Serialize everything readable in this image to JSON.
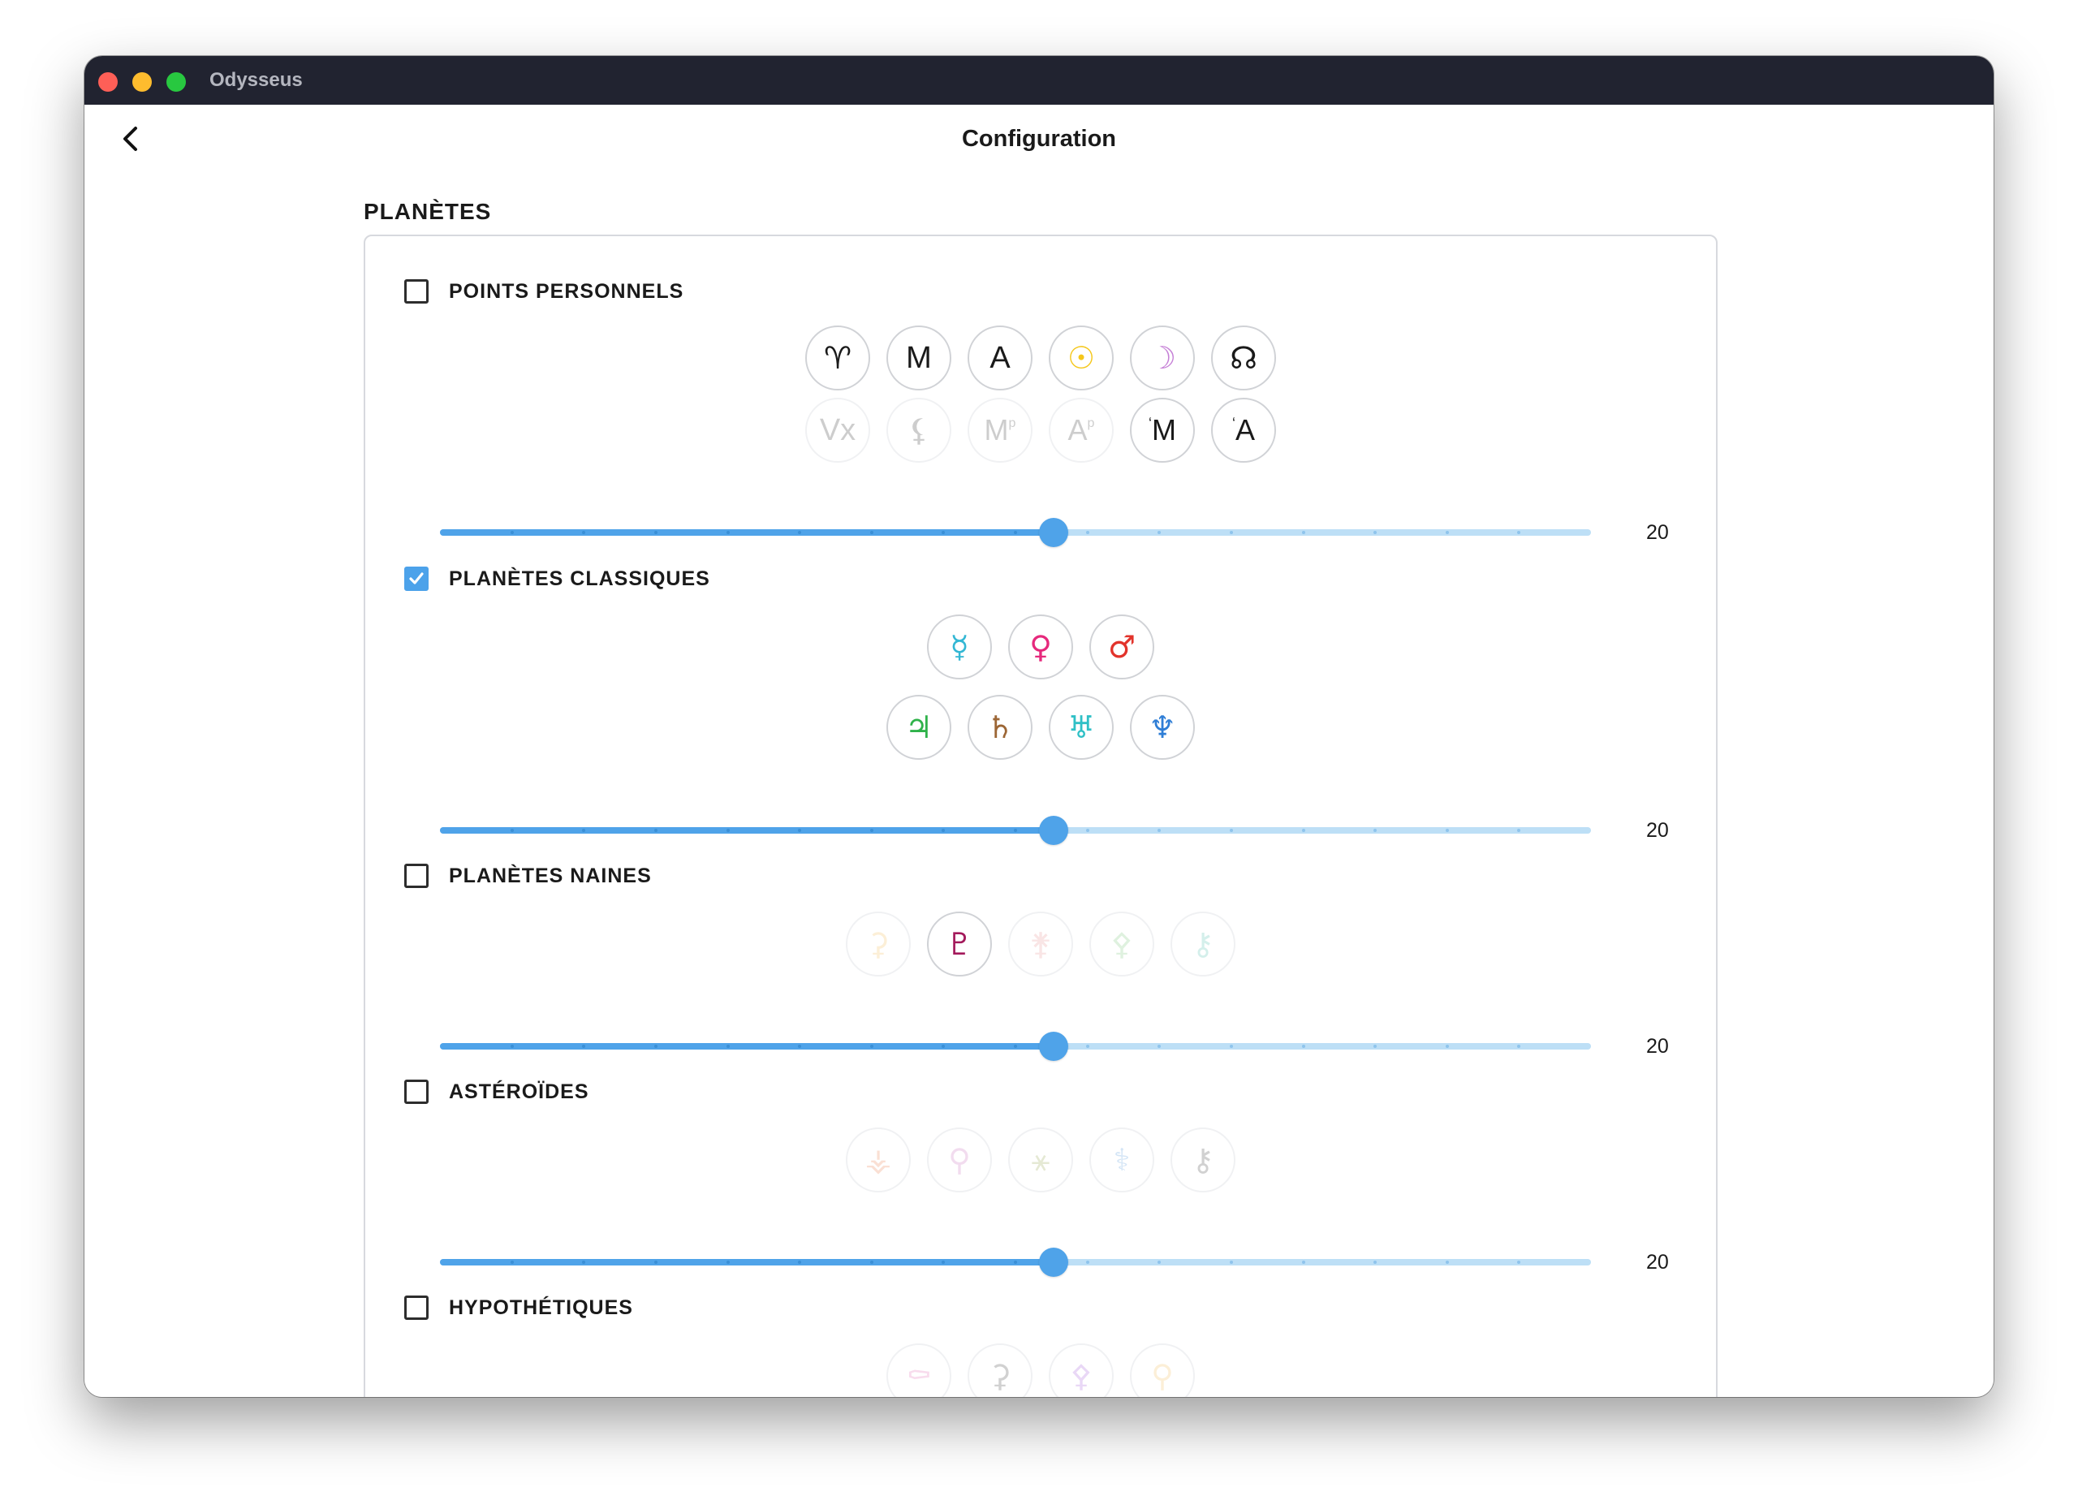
{
  "window": {
    "app_title": "Odysseus"
  },
  "header": {
    "title": "Configuration"
  },
  "section": {
    "title": "PLANÈTES"
  },
  "accent_color": "#4fa3e9",
  "groups": [
    {
      "label": "POINTS PERSONNELS",
      "checked": false,
      "rows": [
        [
          {
            "glyph": "♈︎",
            "name": "aries-point-icon",
            "color": "#1a1a1a",
            "active": true,
            "style": "glyph"
          },
          {
            "glyph": "M",
            "name": "midheaven-icon",
            "color": "#1a1a1a",
            "active": true,
            "style": "letter"
          },
          {
            "glyph": "A",
            "name": "ascendant-icon",
            "color": "#1a1a1a",
            "active": true,
            "style": "letter"
          },
          {
            "glyph": "☉",
            "name": "sun-icon",
            "color": "#f5c71a",
            "active": true,
            "style": "glyph"
          },
          {
            "glyph": "☽",
            "name": "moon-icon",
            "color": "#c57fd6",
            "active": true,
            "style": "glyph"
          },
          {
            "glyph": "☊",
            "name": "north-node-icon",
            "color": "#1a1a1a",
            "active": true,
            "style": "glyph"
          }
        ],
        [
          {
            "glyph": "Vx",
            "name": "vertex-icon",
            "color": "#1a1a1a",
            "active": false,
            "style": "letter"
          },
          {
            "glyph": "⚸",
            "name": "lilith-icon",
            "color": "#1a1a1a",
            "active": false,
            "style": "glyph"
          },
          {
            "glyph": "M",
            "sup": "p",
            "name": "progressed-midheaven-icon",
            "color": "#1a1a1a",
            "active": false,
            "style": "sup"
          },
          {
            "glyph": "A",
            "sup": "p",
            "name": "progressed-ascendant-icon",
            "color": "#1a1a1a",
            "active": false,
            "style": "sup"
          },
          {
            "glyph": "M",
            "pre": "ʻ",
            "name": "vedic-midheaven-icon",
            "color": "#1a1a1a",
            "active": true,
            "style": "pre"
          },
          {
            "glyph": "A",
            "pre": "ʻ",
            "name": "vedic-ascendant-icon",
            "color": "#1a1a1a",
            "active": true,
            "style": "pre"
          }
        ]
      ],
      "slider_value": "20",
      "slider_fraction": 0.533
    },
    {
      "label": "PLANÈTES CLASSIQUES",
      "checked": true,
      "rows": [
        [
          {
            "glyph": "☿",
            "name": "mercury-icon",
            "color": "#33b7d4",
            "active": true,
            "style": "glyph"
          },
          {
            "glyph": "♀",
            "name": "venus-icon",
            "color": "#e6297c",
            "active": true,
            "style": "glyph"
          },
          {
            "glyph": "♂",
            "name": "mars-icon",
            "color": "#e2332b",
            "active": true,
            "style": "glyph"
          }
        ],
        [
          {
            "glyph": "♃",
            "name": "jupiter-icon",
            "color": "#2fb24a",
            "active": true,
            "style": "glyph"
          },
          {
            "glyph": "♄",
            "name": "saturn-icon",
            "color": "#9c6635",
            "active": true,
            "style": "glyph"
          },
          {
            "glyph": "♅",
            "name": "uranus-icon",
            "color": "#2fc0c6",
            "active": true,
            "style": "glyph"
          },
          {
            "glyph": "♆",
            "name": "neptune-icon",
            "color": "#2f7ed6",
            "active": true,
            "style": "glyph"
          }
        ]
      ],
      "slider_value": "20",
      "slider_fraction": 0.533
    },
    {
      "label": "PLANÈTES NAINES",
      "checked": false,
      "rows": [
        [
          {
            "glyph": "⚳",
            "name": "ceres-icon",
            "color": "#f2b84b",
            "active": false,
            "style": "glyph"
          },
          {
            "glyph": "♇",
            "name": "pluto-icon",
            "color": "#a3195b",
            "active": true,
            "style": "glyph"
          },
          {
            "glyph": "⚵",
            "name": "haumea-icon",
            "color": "#e58a8a",
            "active": false,
            "style": "glyph"
          },
          {
            "glyph": "⚴",
            "name": "makemake-icon",
            "color": "#6cbf6c",
            "active": false,
            "style": "glyph"
          },
          {
            "glyph": "⚷",
            "name": "eris-icon",
            "color": "#3bb5a5",
            "active": false,
            "style": "glyph"
          }
        ]
      ],
      "slider_value": "20",
      "slider_fraction": 0.533
    },
    {
      "label": "ASTÉROÏDES",
      "checked": false,
      "rows": [
        [
          {
            "glyph": "⚶",
            "name": "vesta-icon",
            "color": "#e8723a",
            "active": false,
            "style": "glyph"
          },
          {
            "glyph": "⚲",
            "name": "pallas-icon",
            "color": "#c45fb8",
            "active": false,
            "style": "glyph"
          },
          {
            "glyph": "⚹",
            "name": "juno-icon",
            "color": "#8a9a3a",
            "active": false,
            "style": "glyph"
          },
          {
            "glyph": "⚕",
            "name": "hygiea-icon",
            "color": "#3a8ad6",
            "active": false,
            "style": "glyph"
          },
          {
            "glyph": "⚷",
            "name": "chiron-icon",
            "color": "#2d2d2d",
            "active": false,
            "style": "glyph"
          }
        ]
      ],
      "slider_value": "20",
      "slider_fraction": 0.533
    },
    {
      "label": "HYPOTHÉTIQUES",
      "checked": false,
      "rows": [
        [
          {
            "glyph": "⚰",
            "name": "hypothetical-cupido-icon",
            "color": "#e05fae",
            "active": false,
            "style": "glyph"
          },
          {
            "glyph": "⚳",
            "name": "hypothetical-hades-icon",
            "color": "#2d2d2d",
            "active": false,
            "style": "glyph"
          },
          {
            "glyph": "⚴",
            "name": "hypothetical-zeus-icon",
            "color": "#9a4fd6",
            "active": false,
            "style": "glyph"
          },
          {
            "glyph": "⚲",
            "name": "hypothetical-kronos-icon",
            "color": "#f2b84b",
            "active": false,
            "style": "glyph"
          }
        ]
      ]
    }
  ]
}
